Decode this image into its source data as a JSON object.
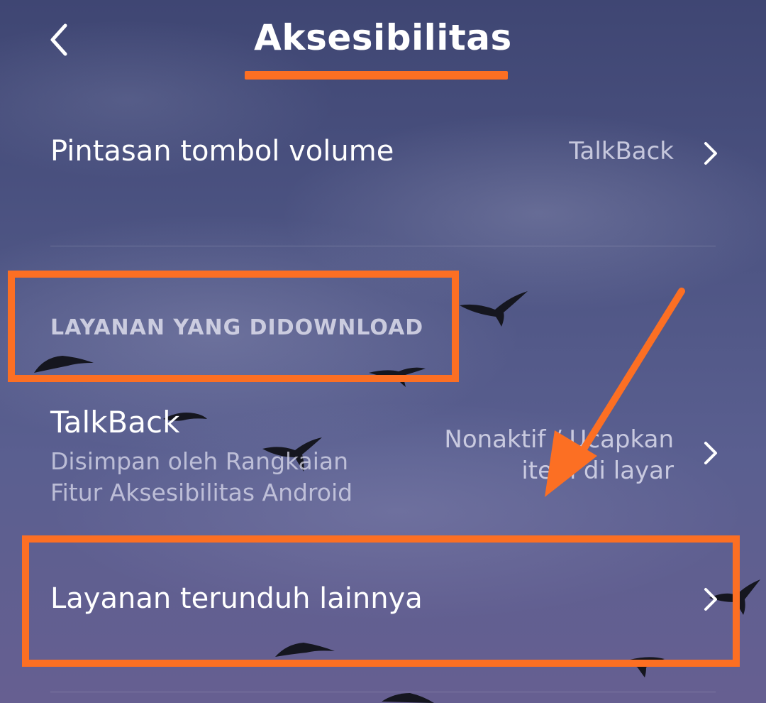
{
  "header": {
    "title": "Aksesibilitas"
  },
  "volume_shortcut": {
    "label": "Pintasan tombol volume",
    "value": "TalkBack"
  },
  "downloaded_section": {
    "header": "LAYANAN YANG DIDOWNLOAD"
  },
  "talkback": {
    "label": "TalkBack",
    "subtitle_line1": "Disimpan oleh Rangkaian",
    "subtitle_line2": "Fitur Aksesibilitas Android",
    "status_line1": "Nonaktif / Ucapkan",
    "status_line2": "item di layar"
  },
  "more_services": {
    "label": "Layanan terunduh lainnya"
  },
  "annotation_color": "#fc6f23",
  "icons": [
    "chevron-left-icon",
    "chevron-right-icon",
    "bird-silhouette-icon",
    "arrow-annotation-icon"
  ]
}
